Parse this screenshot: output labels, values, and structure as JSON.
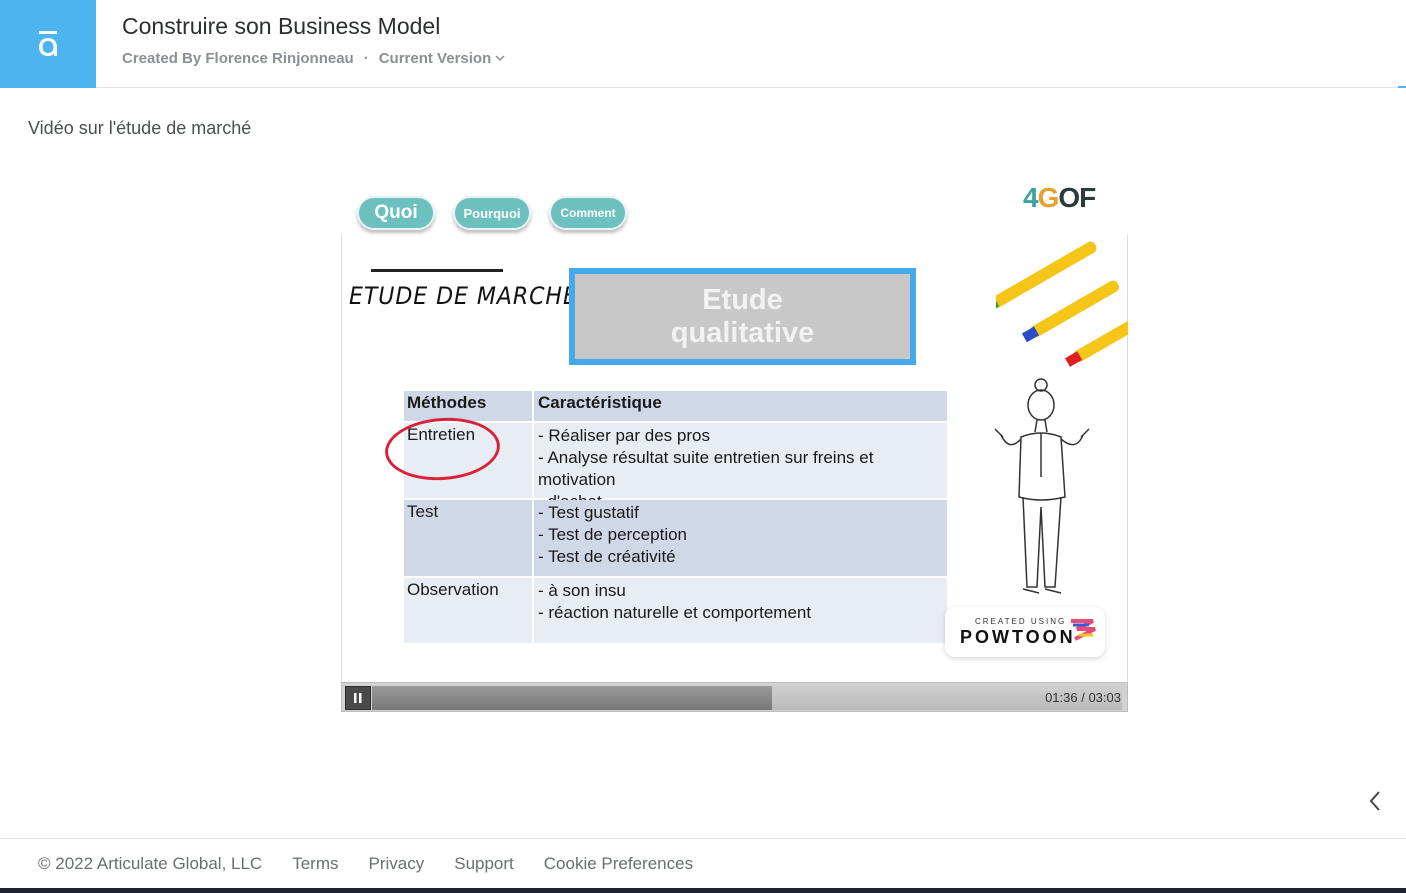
{
  "header": {
    "title": "Construire son Business Model",
    "created_by": "Created By Florence Rinjonneau",
    "separator": "·",
    "version_label": "Current Version",
    "logo_color": "#4cb5f0"
  },
  "lesson": {
    "heading": "Vidéo sur l'étude de marché"
  },
  "video": {
    "nav_buttons": [
      "Quoi",
      "Pourquoi",
      "Comment"
    ],
    "brand": {
      "part1": "4",
      "part2": "G",
      "part3": "OF"
    },
    "etude_title": "ETUDE DE MARCHÉ",
    "qual_line1": "Etude",
    "qual_line2": "qualitative",
    "table": {
      "col1_header": "Méthodes",
      "col2_header": "Caractéristique",
      "rows": [
        {
          "method": "Entretien",
          "items": [
            "- Réaliser par des pros",
            "- Analyse résultat suite entretien sur freins et motivation",
            "  d'achat"
          ]
        },
        {
          "method": "Test",
          "items": [
            "- Test gustatif",
            "- Test de perception",
            "- Test de créativité"
          ]
        },
        {
          "method": "Observation",
          "items": [
            "- à son insu",
            "- réaction naturelle et comportement"
          ]
        }
      ]
    },
    "powtoon_small": "CREATED USING",
    "powtoon_big": "POWTOON",
    "progress_fraction": 0.533,
    "time_current": "01:36",
    "time_total": "03:03",
    "time_separator": " / ",
    "play_icon": "pause-icon"
  },
  "footer": {
    "copyright": "© 2022 Articulate Global, LLC",
    "links": [
      "Terms",
      "Privacy",
      "Support",
      "Cookie Preferences"
    ]
  }
}
